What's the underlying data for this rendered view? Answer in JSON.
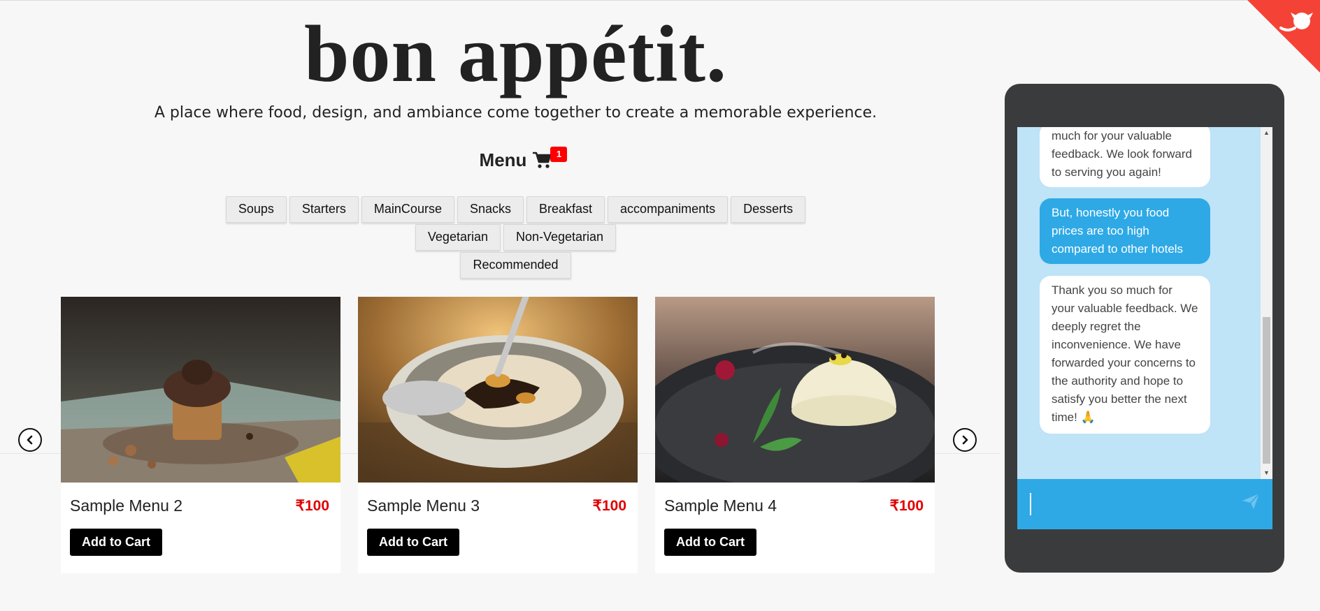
{
  "header": {
    "title": "bon appétit.",
    "tagline": "A place where food, design, and ambiance come together to create a memorable experience."
  },
  "menu": {
    "label": "Menu",
    "cart_count": "1"
  },
  "filters": {
    "row1": [
      "Soups",
      "Starters",
      "MainCourse",
      "Snacks",
      "Breakfast",
      "accompaniments",
      "Desserts"
    ],
    "row2": [
      "Vegetarian",
      "Non-Vegetarian"
    ],
    "row3": [
      "Recommended"
    ]
  },
  "cards": [
    {
      "name": "Sample Menu 2",
      "price": "₹100",
      "button": "Add to Cart",
      "image_icon": "muffin-photo"
    },
    {
      "name": "Sample Menu 3",
      "price": "₹100",
      "button": "Add to Cart",
      "image_icon": "ice-cream-bowl-photo"
    },
    {
      "name": "Sample Menu 4",
      "price": "₹100",
      "button": "Add to Cart",
      "image_icon": "panna-cotta-photo"
    }
  ],
  "chat": {
    "messages": [
      {
        "from": "bot",
        "text": "much for your valuable feedback. We look forward to serving you again!"
      },
      {
        "from": "user",
        "text": "But, honestly you food prices are too high compared to other hotels"
      },
      {
        "from": "bot",
        "text": "Thank you so much for your valuable feedback. We deeply regret the inconvenience. We have forwarded your concerns to the authority and hope to satisfy you better the next time! 🙏"
      }
    ],
    "input_value": ""
  },
  "colors": {
    "accent_blue": "#2ea9e6",
    "chat_bg": "#bfe3f7",
    "price_red": "#e00000",
    "badge_red": "#ff0000",
    "phone_frame": "#3a3b3d",
    "ribbon": "#f44336"
  },
  "icons": [
    "cart-icon",
    "chevron-left-icon",
    "chevron-right-icon",
    "send-icon",
    "github-octocat-icon"
  ]
}
